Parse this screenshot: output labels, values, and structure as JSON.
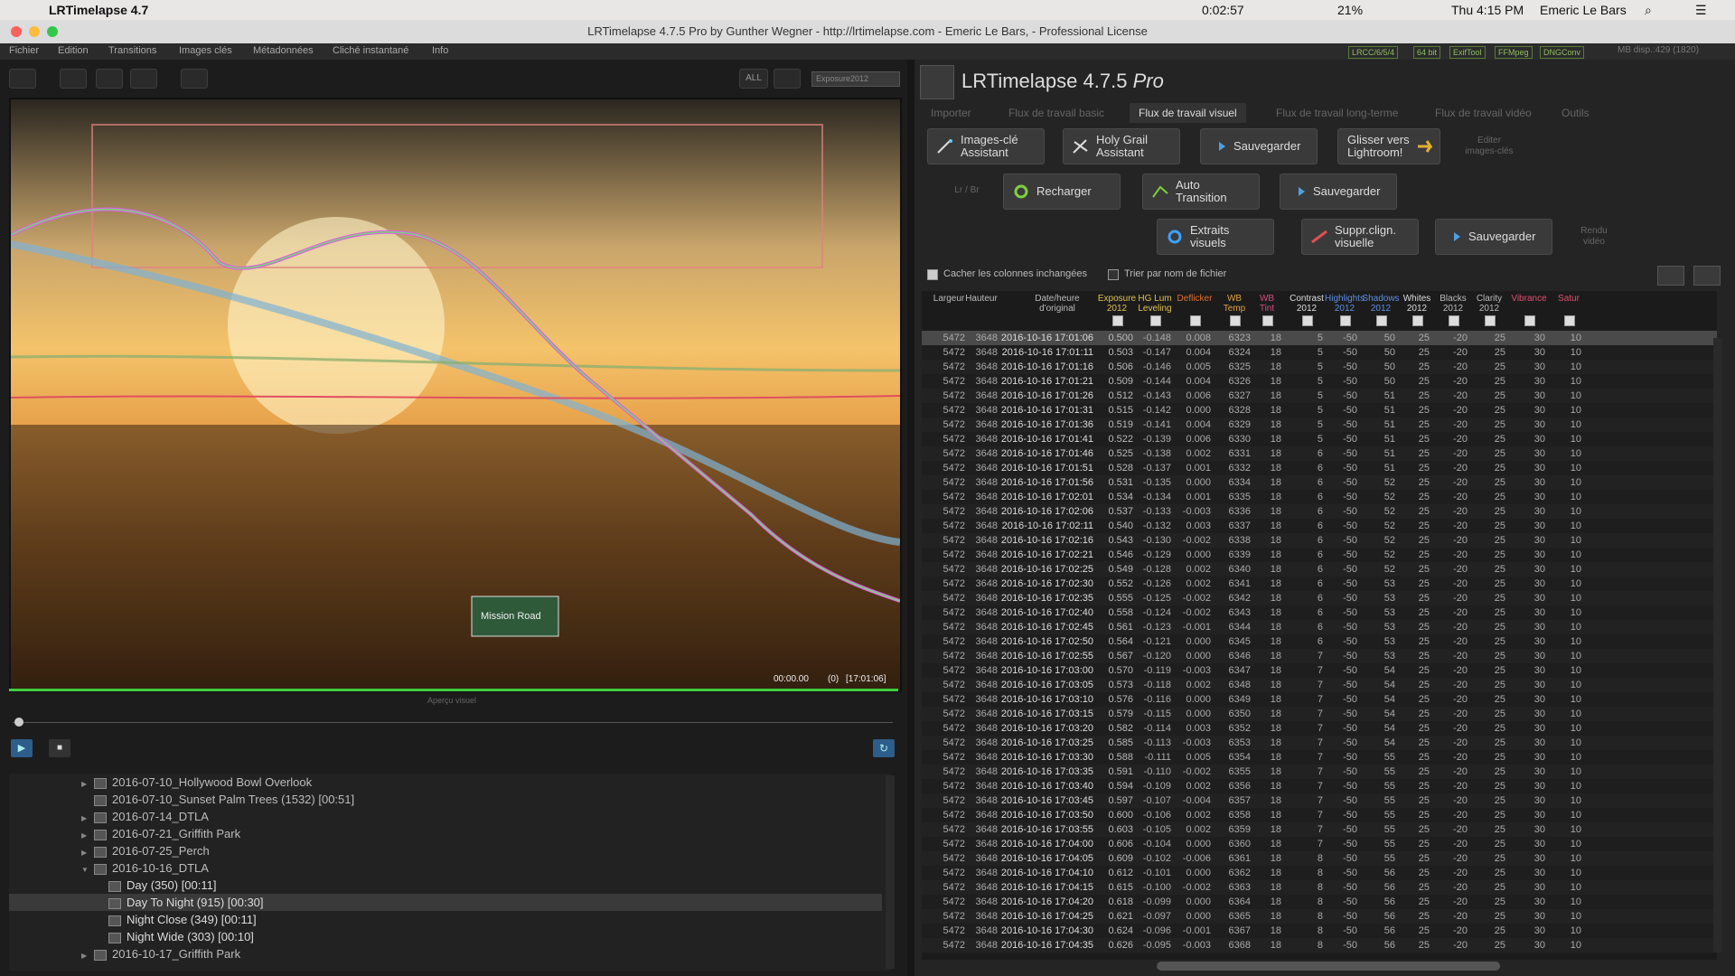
{
  "menubar": {
    "app": "LRTimelapse 4.7",
    "timer": "0:02:57",
    "battery": "21%",
    "datetime": "Thu 4:15 PM",
    "user": "Emeric Le Bars"
  },
  "window": {
    "title": "LRTimelapse 4.7.5 Pro by Gunther Wegner - http://lrtimelapse.com - Emeric Le Bars, - Professional License"
  },
  "appmenu": [
    "Fichier",
    "Edition",
    "Transitions",
    "Images clés",
    "Métadonnées",
    "Cliché instantané",
    "Info"
  ],
  "status_pills": [
    "LRCC/6/5/4",
    "64 bit",
    "ExifTool",
    "FFMpeg",
    "DNGConv"
  ],
  "memory": "MB disp.:429 (1820)",
  "toolbar": {
    "all": "ALL",
    "dropdown": "Exposure2012"
  },
  "preview": {
    "timecode": "00:00.00",
    "frame": "(0)",
    "time": "[17:01:06]",
    "sign": "Mission Road",
    "label": "Aperçu visuel"
  },
  "folders": [
    {
      "name": "2016-07-10_Hollywood Bowl Overlook",
      "indent": 0,
      "arrow": "▶"
    },
    {
      "name": "2016-07-10_Sunset Palm Trees (1532) [00:51]",
      "indent": 0,
      "arrow": ""
    },
    {
      "name": "2016-07-14_DTLA",
      "indent": 0,
      "arrow": "▶"
    },
    {
      "name": "2016-07-21_Griffith Park",
      "indent": 0,
      "arrow": "▶"
    },
    {
      "name": "2016-07-25_Perch",
      "indent": 0,
      "arrow": "▶"
    },
    {
      "name": "2016-10-16_DTLA",
      "indent": 0,
      "arrow": "▼"
    },
    {
      "name": "Day (350) [00:11]",
      "indent": 1,
      "arrow": ""
    },
    {
      "name": "Day To Night (915) [00:30]",
      "indent": 1,
      "arrow": "",
      "selected": true
    },
    {
      "name": "Night Close (349) [00:11]",
      "indent": 1,
      "arrow": ""
    },
    {
      "name": "Night Wide (303) [00:10]",
      "indent": 1,
      "arrow": ""
    },
    {
      "name": "2016-10-17_Griffith Park",
      "indent": 0,
      "arrow": "▶"
    }
  ],
  "app_title": "LRTimelapse 4.7.5",
  "app_edition": "Pro",
  "workflow_tabs": [
    "Importer",
    "Flux de travail basic",
    "Flux de travail visuel",
    "Flux de travail long-terme",
    "Flux de travail vidéo",
    "Outils"
  ],
  "buttons": {
    "keyframes": "Images-clé\nAssistant",
    "holygrail": "Holy Grail\nAssistant",
    "save1": "Sauvegarder",
    "drag": "Glisser vers\nLightroom!",
    "edit_side": "Editer\nimages-clés",
    "lrbr": "Lr / Br",
    "reload": "Recharger",
    "auto": "Auto\nTransition",
    "save2": "Sauvegarder",
    "extracts": "Extraits\nvisuels",
    "deflicker": "Suppr.clign.\nvisuelle",
    "save3": "Sauvegarder",
    "render_side": "Rendu\nvidéo"
  },
  "options": {
    "hide_cols": "Cacher les colonnes inchangées",
    "sort": "Trier par nom de fichier"
  },
  "table": {
    "headers": [
      {
        "t": "Largeur",
        "c": "#bbb"
      },
      {
        "t": "Hauteur",
        "c": "#bbb"
      },
      {
        "t": "Date/heure\nd'original",
        "c": "#bbb"
      },
      {
        "t": "Exposure\n2012",
        "c": "#e0c050"
      },
      {
        "t": "HG Lum\nLeveling",
        "c": "#e0c050"
      },
      {
        "t": "Deflicker",
        "c": "#e07030"
      },
      {
        "t": "WB\nTemp",
        "c": "#e0a040"
      },
      {
        "t": "WB\nTint",
        "c": "#d05080"
      },
      {
        "t": "Contrast\n2012",
        "c": "#ddd"
      },
      {
        "t": "Highlights\n2012",
        "c": "#6090e0"
      },
      {
        "t": "Shadows\n2012",
        "c": "#6090e0"
      },
      {
        "t": "Whites\n2012",
        "c": "#ddd"
      },
      {
        "t": "Blacks\n2012",
        "c": "#bbb"
      },
      {
        "t": "Clarity\n2012",
        "c": "#bbb"
      },
      {
        "t": "Vibrance",
        "c": "#e05070"
      },
      {
        "t": "Satur",
        "c": "#e05070"
      }
    ],
    "rows": [
      [
        "5472",
        "3648",
        "2016-10-16 17:01:06",
        "0.500",
        "-0.148",
        "0.008",
        "6323",
        "18",
        "5",
        "-50",
        "50",
        "25",
        "-20",
        "25",
        "30",
        "10"
      ],
      [
        "5472",
        "3648",
        "2016-10-16 17:01:11",
        "0.503",
        "-0.147",
        "0.004",
        "6324",
        "18",
        "5",
        "-50",
        "50",
        "25",
        "-20",
        "25",
        "30",
        "10"
      ],
      [
        "5472",
        "3648",
        "2016-10-16 17:01:16",
        "0.506",
        "-0.146",
        "0.005",
        "6325",
        "18",
        "5",
        "-50",
        "50",
        "25",
        "-20",
        "25",
        "30",
        "10"
      ],
      [
        "5472",
        "3648",
        "2016-10-16 17:01:21",
        "0.509",
        "-0.144",
        "0.004",
        "6326",
        "18",
        "5",
        "-50",
        "50",
        "25",
        "-20",
        "25",
        "30",
        "10"
      ],
      [
        "5472",
        "3648",
        "2016-10-16 17:01:26",
        "0.512",
        "-0.143",
        "0.006",
        "6327",
        "18",
        "5",
        "-50",
        "51",
        "25",
        "-20",
        "25",
        "30",
        "10"
      ],
      [
        "5472",
        "3648",
        "2016-10-16 17:01:31",
        "0.515",
        "-0.142",
        "0.000",
        "6328",
        "18",
        "5",
        "-50",
        "51",
        "25",
        "-20",
        "25",
        "30",
        "10"
      ],
      [
        "5472",
        "3648",
        "2016-10-16 17:01:36",
        "0.519",
        "-0.141",
        "0.004",
        "6329",
        "18",
        "5",
        "-50",
        "51",
        "25",
        "-20",
        "25",
        "30",
        "10"
      ],
      [
        "5472",
        "3648",
        "2016-10-16 17:01:41",
        "0.522",
        "-0.139",
        "0.006",
        "6330",
        "18",
        "5",
        "-50",
        "51",
        "25",
        "-20",
        "25",
        "30",
        "10"
      ],
      [
        "5472",
        "3648",
        "2016-10-16 17:01:46",
        "0.525",
        "-0.138",
        "0.002",
        "6331",
        "18",
        "6",
        "-50",
        "51",
        "25",
        "-20",
        "25",
        "30",
        "10"
      ],
      [
        "5472",
        "3648",
        "2016-10-16 17:01:51",
        "0.528",
        "-0.137",
        "0.001",
        "6332",
        "18",
        "6",
        "-50",
        "51",
        "25",
        "-20",
        "25",
        "30",
        "10"
      ],
      [
        "5472",
        "3648",
        "2016-10-16 17:01:56",
        "0.531",
        "-0.135",
        "0.000",
        "6334",
        "18",
        "6",
        "-50",
        "52",
        "25",
        "-20",
        "25",
        "30",
        "10"
      ],
      [
        "5472",
        "3648",
        "2016-10-16 17:02:01",
        "0.534",
        "-0.134",
        "0.001",
        "6335",
        "18",
        "6",
        "-50",
        "52",
        "25",
        "-20",
        "25",
        "30",
        "10"
      ],
      [
        "5472",
        "3648",
        "2016-10-16 17:02:06",
        "0.537",
        "-0.133",
        "-0.003",
        "6336",
        "18",
        "6",
        "-50",
        "52",
        "25",
        "-20",
        "25",
        "30",
        "10"
      ],
      [
        "5472",
        "3648",
        "2016-10-16 17:02:11",
        "0.540",
        "-0.132",
        "0.003",
        "6337",
        "18",
        "6",
        "-50",
        "52",
        "25",
        "-20",
        "25",
        "30",
        "10"
      ],
      [
        "5472",
        "3648",
        "2016-10-16 17:02:16",
        "0.543",
        "-0.130",
        "-0.002",
        "6338",
        "18",
        "6",
        "-50",
        "52",
        "25",
        "-20",
        "25",
        "30",
        "10"
      ],
      [
        "5472",
        "3648",
        "2016-10-16 17:02:21",
        "0.546",
        "-0.129",
        "0.000",
        "6339",
        "18",
        "6",
        "-50",
        "52",
        "25",
        "-20",
        "25",
        "30",
        "10"
      ],
      [
        "5472",
        "3648",
        "2016-10-16 17:02:25",
        "0.549",
        "-0.128",
        "0.002",
        "6340",
        "18",
        "6",
        "-50",
        "52",
        "25",
        "-20",
        "25",
        "30",
        "10"
      ],
      [
        "5472",
        "3648",
        "2016-10-16 17:02:30",
        "0.552",
        "-0.126",
        "0.002",
        "6341",
        "18",
        "6",
        "-50",
        "53",
        "25",
        "-20",
        "25",
        "30",
        "10"
      ],
      [
        "5472",
        "3648",
        "2016-10-16 17:02:35",
        "0.555",
        "-0.125",
        "-0.002",
        "6342",
        "18",
        "6",
        "-50",
        "53",
        "25",
        "-20",
        "25",
        "30",
        "10"
      ],
      [
        "5472",
        "3648",
        "2016-10-16 17:02:40",
        "0.558",
        "-0.124",
        "-0.002",
        "6343",
        "18",
        "6",
        "-50",
        "53",
        "25",
        "-20",
        "25",
        "30",
        "10"
      ],
      [
        "5472",
        "3648",
        "2016-10-16 17:02:45",
        "0.561",
        "-0.123",
        "-0.001",
        "6344",
        "18",
        "6",
        "-50",
        "53",
        "25",
        "-20",
        "25",
        "30",
        "10"
      ],
      [
        "5472",
        "3648",
        "2016-10-16 17:02:50",
        "0.564",
        "-0.121",
        "0.000",
        "6345",
        "18",
        "6",
        "-50",
        "53",
        "25",
        "-20",
        "25",
        "30",
        "10"
      ],
      [
        "5472",
        "3648",
        "2016-10-16 17:02:55",
        "0.567",
        "-0.120",
        "0.000",
        "6346",
        "18",
        "7",
        "-50",
        "53",
        "25",
        "-20",
        "25",
        "30",
        "10"
      ],
      [
        "5472",
        "3648",
        "2016-10-16 17:03:00",
        "0.570",
        "-0.119",
        "-0.003",
        "6347",
        "18",
        "7",
        "-50",
        "54",
        "25",
        "-20",
        "25",
        "30",
        "10"
      ],
      [
        "5472",
        "3648",
        "2016-10-16 17:03:05",
        "0.573",
        "-0.118",
        "0.002",
        "6348",
        "18",
        "7",
        "-50",
        "54",
        "25",
        "-20",
        "25",
        "30",
        "10"
      ],
      [
        "5472",
        "3648",
        "2016-10-16 17:03:10",
        "0.576",
        "-0.116",
        "0.000",
        "6349",
        "18",
        "7",
        "-50",
        "54",
        "25",
        "-20",
        "25",
        "30",
        "10"
      ],
      [
        "5472",
        "3648",
        "2016-10-16 17:03:15",
        "0.579",
        "-0.115",
        "0.000",
        "6350",
        "18",
        "7",
        "-50",
        "54",
        "25",
        "-20",
        "25",
        "30",
        "10"
      ],
      [
        "5472",
        "3648",
        "2016-10-16 17:03:20",
        "0.582",
        "-0.114",
        "0.003",
        "6352",
        "18",
        "7",
        "-50",
        "54",
        "25",
        "-20",
        "25",
        "30",
        "10"
      ],
      [
        "5472",
        "3648",
        "2016-10-16 17:03:25",
        "0.585",
        "-0.113",
        "-0.003",
        "6353",
        "18",
        "7",
        "-50",
        "54",
        "25",
        "-20",
        "25",
        "30",
        "10"
      ],
      [
        "5472",
        "3648",
        "2016-10-16 17:03:30",
        "0.588",
        "-0.111",
        "0.005",
        "6354",
        "18",
        "7",
        "-50",
        "55",
        "25",
        "-20",
        "25",
        "30",
        "10"
      ],
      [
        "5472",
        "3648",
        "2016-10-16 17:03:35",
        "0.591",
        "-0.110",
        "-0.002",
        "6355",
        "18",
        "7",
        "-50",
        "55",
        "25",
        "-20",
        "25",
        "30",
        "10"
      ],
      [
        "5472",
        "3648",
        "2016-10-16 17:03:40",
        "0.594",
        "-0.109",
        "0.002",
        "6356",
        "18",
        "7",
        "-50",
        "55",
        "25",
        "-20",
        "25",
        "30",
        "10"
      ],
      [
        "5472",
        "3648",
        "2016-10-16 17:03:45",
        "0.597",
        "-0.107",
        "-0.004",
        "6357",
        "18",
        "7",
        "-50",
        "55",
        "25",
        "-20",
        "25",
        "30",
        "10"
      ],
      [
        "5472",
        "3648",
        "2016-10-16 17:03:50",
        "0.600",
        "-0.106",
        "0.002",
        "6358",
        "18",
        "7",
        "-50",
        "55",
        "25",
        "-20",
        "25",
        "30",
        "10"
      ],
      [
        "5472",
        "3648",
        "2016-10-16 17:03:55",
        "0.603",
        "-0.105",
        "0.002",
        "6359",
        "18",
        "7",
        "-50",
        "55",
        "25",
        "-20",
        "25",
        "30",
        "10"
      ],
      [
        "5472",
        "3648",
        "2016-10-16 17:04:00",
        "0.606",
        "-0.104",
        "0.000",
        "6360",
        "18",
        "7",
        "-50",
        "55",
        "25",
        "-20",
        "25",
        "30",
        "10"
      ],
      [
        "5472",
        "3648",
        "2016-10-16 17:04:05",
        "0.609",
        "-0.102",
        "-0.006",
        "6361",
        "18",
        "8",
        "-50",
        "55",
        "25",
        "-20",
        "25",
        "30",
        "10"
      ],
      [
        "5472",
        "3648",
        "2016-10-16 17:04:10",
        "0.612",
        "-0.101",
        "0.000",
        "6362",
        "18",
        "8",
        "-50",
        "56",
        "25",
        "-20",
        "25",
        "30",
        "10"
      ],
      [
        "5472",
        "3648",
        "2016-10-16 17:04:15",
        "0.615",
        "-0.100",
        "-0.002",
        "6363",
        "18",
        "8",
        "-50",
        "56",
        "25",
        "-20",
        "25",
        "30",
        "10"
      ],
      [
        "5472",
        "3648",
        "2016-10-16 17:04:20",
        "0.618",
        "-0.099",
        "0.000",
        "6364",
        "18",
        "8",
        "-50",
        "56",
        "25",
        "-20",
        "25",
        "30",
        "10"
      ],
      [
        "5472",
        "3648",
        "2016-10-16 17:04:25",
        "0.621",
        "-0.097",
        "0.000",
        "6365",
        "18",
        "8",
        "-50",
        "56",
        "25",
        "-20",
        "25",
        "30",
        "10"
      ],
      [
        "5472",
        "3648",
        "2016-10-16 17:04:30",
        "0.624",
        "-0.096",
        "-0.001",
        "6367",
        "18",
        "8",
        "-50",
        "56",
        "25",
        "-20",
        "25",
        "30",
        "10"
      ],
      [
        "5472",
        "3648",
        "2016-10-16 17:04:35",
        "0.626",
        "-0.095",
        "-0.003",
        "6368",
        "18",
        "8",
        "-50",
        "56",
        "25",
        "-20",
        "25",
        "30",
        "10"
      ]
    ]
  }
}
